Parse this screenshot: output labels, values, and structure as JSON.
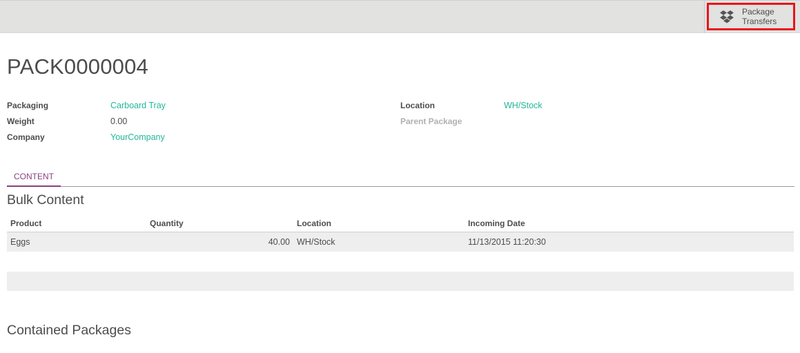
{
  "toolbar": {
    "package_transfers_line1": "Package",
    "package_transfers_line2": "Transfers"
  },
  "package": {
    "name": "PACK0000004"
  },
  "fields": {
    "packaging_label": "Packaging",
    "packaging_value": "Carboard Tray",
    "weight_label": "Weight",
    "weight_value": "0.00",
    "company_label": "Company",
    "company_value": "YourCompany",
    "location_label": "Location",
    "location_value": "WH/Stock",
    "parent_package_label": "Parent Package"
  },
  "tabs": [
    {
      "label": "CONTENT",
      "active": true
    }
  ],
  "bulk_content": {
    "title": "Bulk Content",
    "columns": [
      "Product",
      "Quantity",
      "Location",
      "Incoming Date"
    ],
    "rows": [
      {
        "product": "Eggs",
        "quantity": "40.00",
        "location": "WH/Stock",
        "incoming_date": "11/13/2015 11:20:30"
      }
    ]
  },
  "contained_packages": {
    "title": "Contained Packages"
  },
  "colors": {
    "link": "#21b799",
    "tab_active": "#8a3f7f",
    "highlight_border": "#e8141b"
  }
}
